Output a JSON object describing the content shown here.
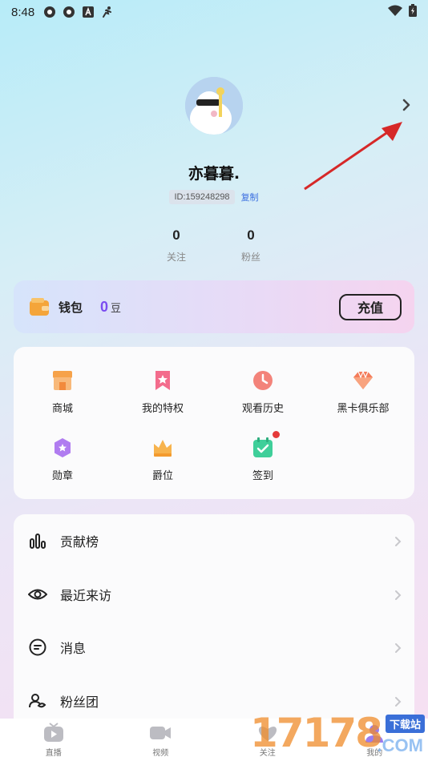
{
  "status_bar": {
    "time": "8:48"
  },
  "profile": {
    "nickname": "亦暮暮.",
    "id_text": "ID:159248298",
    "copy_label": "复制",
    "stats": [
      {
        "value": "0",
        "label": "关注"
      },
      {
        "value": "0",
        "label": "粉丝"
      }
    ]
  },
  "wallet": {
    "label": "钱包",
    "balance": "0",
    "unit": "豆",
    "recharge_label": "充值"
  },
  "features": {
    "items": [
      {
        "label": "商城",
        "icon": "shop-icon"
      },
      {
        "label": "我的特权",
        "icon": "privilege-icon"
      },
      {
        "label": "观看历史",
        "icon": "history-icon"
      },
      {
        "label": "黑卡俱乐部",
        "icon": "diamond-icon"
      },
      {
        "label": "勋章",
        "icon": "medal-icon"
      },
      {
        "label": "爵位",
        "icon": "crown-icon"
      },
      {
        "label": "签到",
        "icon": "checkin-icon"
      }
    ]
  },
  "menu": {
    "items": [
      {
        "label": "贡献榜",
        "icon": "bar-chart-icon"
      },
      {
        "label": "最近来访",
        "icon": "eye-icon"
      },
      {
        "label": "消息",
        "icon": "message-icon"
      },
      {
        "label": "粉丝团",
        "icon": "fan-group-icon"
      }
    ]
  },
  "tabbar": {
    "tabs": [
      {
        "label": "直播",
        "icon": "live-icon"
      },
      {
        "label": "视频",
        "icon": "video-icon"
      },
      {
        "label": "关注",
        "icon": "follow-icon"
      },
      {
        "label": "我的",
        "icon": "profile-icon"
      }
    ]
  },
  "watermark": {
    "digits": "17178",
    "site": "下载站",
    "domain": ".COM"
  },
  "colors": {
    "accent": "#7b4cf0",
    "link": "#3b6fe0",
    "badge_red": "#e53a3a",
    "annotation_arrow": "#d62828"
  }
}
